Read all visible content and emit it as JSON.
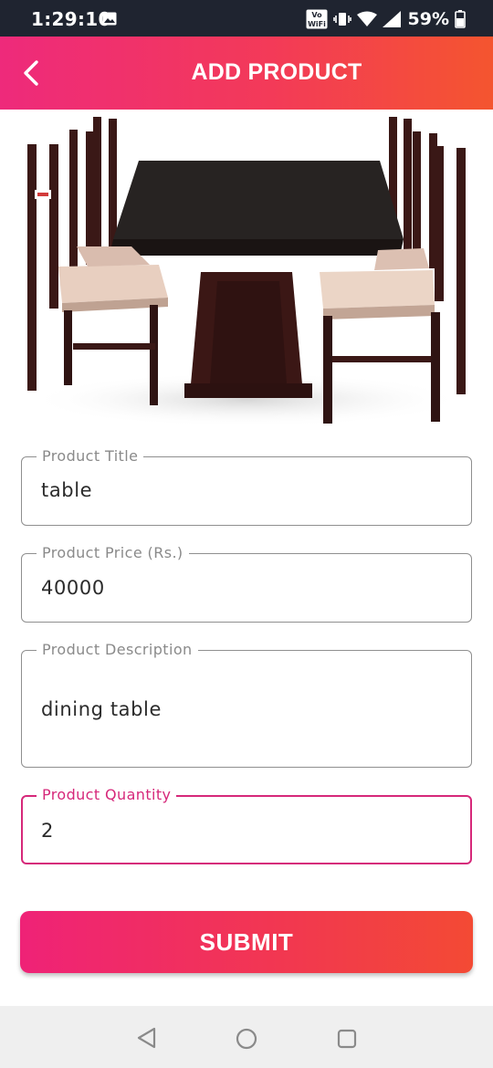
{
  "status_bar": {
    "time": "1:29:10",
    "battery_percent": "59%",
    "volte_label_top": "Vo",
    "volte_label_bottom": "WiFi",
    "icons": [
      "gallery-icon",
      "volte-wifi-icon",
      "vibrate-icon",
      "wifi-icon",
      "signal-icon",
      "battery-icon"
    ]
  },
  "app_bar": {
    "title": "ADD PRODUCT",
    "back_icon": "chevron-left-icon"
  },
  "form": {
    "title": {
      "label": "Product Title",
      "value": "table"
    },
    "price": {
      "label": "Product Price (Rs.)",
      "value": "40000"
    },
    "description": {
      "label": "Product Description",
      "value": "dining table"
    },
    "quantity": {
      "label": "Product Quantity",
      "value": "2",
      "focused": true
    }
  },
  "submit_label": "SUBMIT",
  "colors": {
    "gradient_start": "#ee2a7b",
    "gradient_end": "#f4552f",
    "focus_accent": "#d6287a",
    "status_bar_bg": "#1f2430"
  },
  "nav_bar": {
    "icons": [
      "nav-back-icon",
      "nav-home-icon",
      "nav-recents-icon"
    ]
  }
}
